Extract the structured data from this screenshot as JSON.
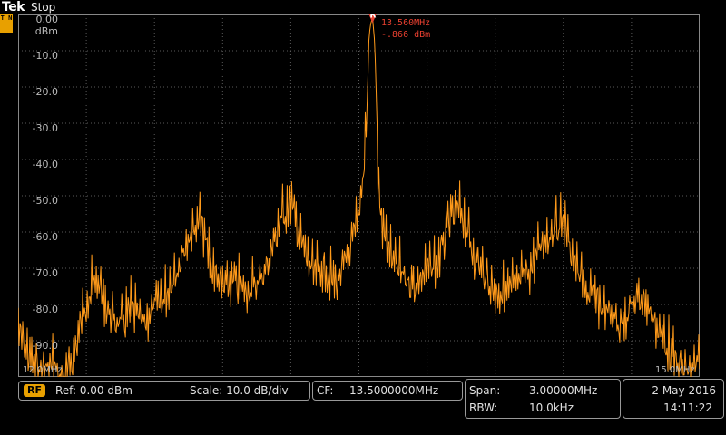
{
  "header": {
    "brand": "Tek",
    "acq_state": "Stop",
    "trigger_badge": "T N"
  },
  "colors": {
    "trace": "#ff9a1a",
    "marker": "#e94030",
    "grid": "#5a5a5a",
    "accent": "#e8a000"
  },
  "y_labels": [
    "0.00 dBm",
    "-10.0",
    "-20.0",
    "-30.0",
    "-40.0",
    "-50.0",
    "-60.0",
    "-70.0",
    "-80.0",
    "-90.0"
  ],
  "x_labels": {
    "start": "12.0MHz",
    "stop": "15.0MHz"
  },
  "marker": {
    "label": "R",
    "frequency": "13.560MHz",
    "amplitude": "-.866 dBm"
  },
  "status": {
    "rf_badge": "RF",
    "ref": "Ref: 0.00 dBm",
    "scale": "Scale: 10.0 dB/div",
    "cf_label": "CF:",
    "cf_value": "13.5000000MHz",
    "span_label": "Span:",
    "span_value": "3.00000MHz",
    "rbw_label": "RBW:",
    "rbw_value": "10.0kHz",
    "date": "2 May  2016",
    "time": "14:11:22"
  },
  "chart_data": {
    "type": "line",
    "xlabel": "",
    "ylabel": "",
    "xlim": [
      12.0,
      15.0
    ],
    "ylim": [
      -96,
      0
    ],
    "series": [
      {
        "x": [
          12.0,
          12.05,
          12.1,
          12.15,
          12.2,
          12.25,
          12.3,
          12.35,
          12.4,
          12.45,
          12.5,
          12.55,
          12.6,
          12.65,
          12.7,
          12.75,
          12.8,
          12.85,
          12.9,
          12.95,
          13.0,
          13.05,
          13.1,
          13.15,
          13.2,
          13.25,
          13.3,
          13.35,
          13.4,
          13.45,
          13.5,
          13.52,
          13.54,
          13.55,
          13.56,
          13.57,
          13.58,
          13.6,
          13.65,
          13.7,
          13.75,
          13.8,
          13.85,
          13.9,
          13.95,
          14.0,
          14.05,
          14.1,
          14.15,
          14.2,
          14.25,
          14.3,
          14.35,
          14.4,
          14.45,
          14.5,
          14.55,
          14.6,
          14.65,
          14.7,
          14.75,
          14.8,
          14.85,
          14.9,
          14.95,
          15.0
        ],
        "y": [
          -77,
          -84,
          -88,
          -86,
          -92,
          -82,
          -68,
          -63,
          -72,
          -75,
          -71,
          -75,
          -70,
          -67,
          -59,
          -51,
          -46,
          -59,
          -65,
          -63,
          -66,
          -64,
          -58,
          -47,
          -41,
          -53,
          -61,
          -60,
          -64,
          -57,
          -46,
          -32,
          -10,
          -3,
          -0.866,
          -8,
          -30,
          -47,
          -58,
          -62,
          -64,
          -60,
          -58,
          -46,
          -43,
          -55,
          -61,
          -66,
          -66,
          -64,
          -60,
          -53,
          -49,
          -46,
          -58,
          -66,
          -69,
          -72,
          -75,
          -70,
          -67,
          -74,
          -80,
          -86,
          -88,
          -86
        ]
      }
    ]
  }
}
